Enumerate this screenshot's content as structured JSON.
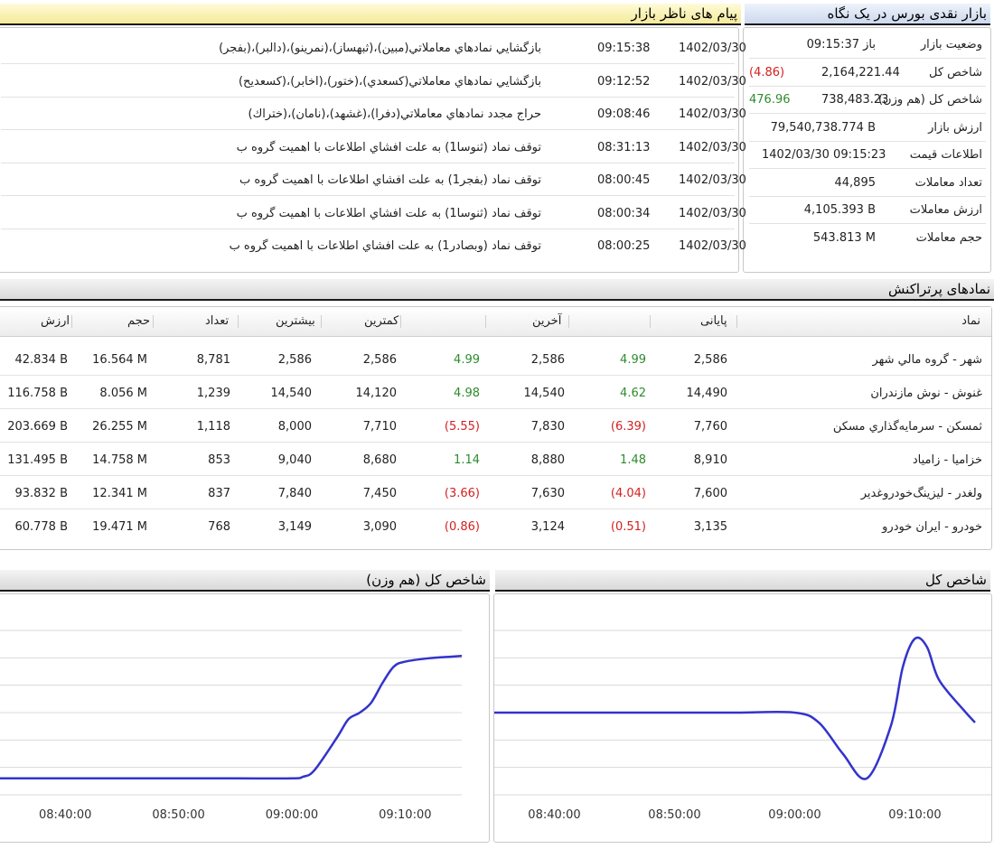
{
  "overview": {
    "title": "بازار نقدی بورس در یک نگاه",
    "rows": [
      {
        "label": "وضعیت بازار",
        "value": "باز 09:15:37",
        "change": "",
        "change_sign": ""
      },
      {
        "label": "شاخص کل",
        "value": "2,164,221.44",
        "change": "(4.86)",
        "change_sign": "neg"
      },
      {
        "label": "شاخص کل (هم وزن)",
        "value": "738,483.23",
        "change": "476.96",
        "change_sign": "pos"
      },
      {
        "label": "ارزش بازار",
        "value": "79,540,738.774 B",
        "change": "",
        "change_sign": ""
      },
      {
        "label": "اطلاعات قیمت",
        "value": "1402/03/30 09:15:23",
        "change": "",
        "change_sign": ""
      },
      {
        "label": "تعداد معاملات",
        "value": "44,895",
        "change": "",
        "change_sign": ""
      },
      {
        "label": "ارزش معاملات",
        "value": "4,105.393 B",
        "change": "",
        "change_sign": ""
      },
      {
        "label": "حجم معاملات",
        "value": "543.813 M",
        "change": "",
        "change_sign": ""
      }
    ]
  },
  "messages": {
    "title": "پیام های ناظر بازار",
    "rows": [
      {
        "date": "1402/03/30",
        "time": "09:15:38",
        "text": "بازگشايي نمادهاي معاملاتي(مبين)،(ثبهساز)،(نمرينو)،(دالبر)،(بفجر)"
      },
      {
        "date": "1402/03/30",
        "time": "09:12:52",
        "text": "بازگشايي نمادهاي معاملاتي(كسعدي)،(ختور)،(اخابر)،(كسعديح)"
      },
      {
        "date": "1402/03/30",
        "time": "09:08:46",
        "text": "حراج مجدد نمادهاي معاملاتي(دفرا)،(غشهد)،(نامان)،(ختراك)"
      },
      {
        "date": "1402/03/30",
        "time": "08:31:13",
        "text": "توقف نماد (ثنوسا1) به علت افشاي اطلاعات با اهميت گروه ب"
      },
      {
        "date": "1402/03/30",
        "time": "08:00:45",
        "text": "توقف نماد (بفجر1) به علت افشاي اطلاعات با اهميت گروه ب"
      },
      {
        "date": "1402/03/30",
        "time": "08:00:34",
        "text": "توقف نماد (ثنوسا1) به علت افشاي اطلاعات با اهميت گروه ب"
      },
      {
        "date": "1402/03/30",
        "time": "08:00:25",
        "text": "توقف نماد (وبصادر1) به علت افشاي اطلاعات با اهميت گروه ب"
      }
    ]
  },
  "symbols": {
    "title": "نمادهای پرتراکنش",
    "headers": {
      "symbol": "نماد",
      "close": "پایانی",
      "last": "آخرین",
      "low": "کمترین",
      "high": "بیشترین",
      "count": "تعداد",
      "volume": "حجم",
      "value": "ارزش"
    },
    "rows": [
      {
        "name": "شهر - گروه مالي شهر",
        "close": "2,586",
        "close_chg": "4.99",
        "close_sign": "pos",
        "last": "2,586",
        "last_chg": "4.99",
        "last_sign": "pos",
        "low": "2,586",
        "high": "2,586",
        "count": "8,781",
        "volume": "16.564 M",
        "value": "42.834 B"
      },
      {
        "name": "غنوش - نوش مازندران",
        "close": "14,490",
        "close_chg": "4.62",
        "close_sign": "pos",
        "last": "14,540",
        "last_chg": "4.98",
        "last_sign": "pos",
        "low": "14,120",
        "high": "14,540",
        "count": "1,239",
        "volume": "8.056 M",
        "value": "116.758 B"
      },
      {
        "name": "ثمسكن - سرمايه‌گذاري مسكن",
        "close": "7,760",
        "close_chg": "(6.39)",
        "close_sign": "neg",
        "last": "7,830",
        "last_chg": "(5.55)",
        "last_sign": "neg",
        "low": "7,710",
        "high": "8,000",
        "count": "1,118",
        "volume": "26.255 M",
        "value": "203.669 B"
      },
      {
        "name": "خزاميا - زامياد",
        "close": "8,910",
        "close_chg": "1.48",
        "close_sign": "pos",
        "last": "8,880",
        "last_chg": "1.14",
        "last_sign": "pos",
        "low": "8,680",
        "high": "9,040",
        "count": "853",
        "volume": "14.758 M",
        "value": "131.495 B"
      },
      {
        "name": "ولغدر - ليزينگ‌خودروغدير",
        "close": "7,600",
        "close_chg": "(4.04)",
        "close_sign": "neg",
        "last": "7,630",
        "last_chg": "(3.66)",
        "last_sign": "neg",
        "low": "7,450",
        "high": "7,840",
        "count": "837",
        "volume": "12.341 M",
        "value": "93.832 B"
      },
      {
        "name": "خودرو - ايران خودرو",
        "close": "3,135",
        "close_chg": "(0.51)",
        "close_sign": "neg",
        "last": "3,124",
        "last_chg": "(0.86)",
        "last_sign": "neg",
        "low": "3,090",
        "high": "3,149",
        "count": "768",
        "volume": "19.471 M",
        "value": "60.778 B"
      }
    ]
  },
  "colors": {
    "line": "#3333cc",
    "positive": "#2e8b2e",
    "negative": "#d42020",
    "grid": "#d8d8d8"
  },
  "chart_data": [
    {
      "type": "line",
      "title": "شاخص کل",
      "x": [
        "08:35:00",
        "08:40:00",
        "08:45:00",
        "08:50:00",
        "08:55:00",
        "09:00:00",
        "09:02:00",
        "09:04:00",
        "09:06:00",
        "09:08:00",
        "09:09:00",
        "09:10:00",
        "09:11:00",
        "09:12:00",
        "09:14:00",
        "09:15:00"
      ],
      "y": [
        0.5,
        0.5,
        0.5,
        0.5,
        0.5,
        0.5,
        0.44,
        0.25,
        0.1,
        0.42,
        0.78,
        0.95,
        0.9,
        0.7,
        0.52,
        0.44
      ],
      "xticks": [
        "08:40:00",
        "08:50:00",
        "09:00:00",
        "09:10:00"
      ],
      "ylim": [
        0,
        1
      ],
      "grid": true
    },
    {
      "type": "line",
      "title": "شاخص کل (هم وزن)",
      "x": [
        "08:34:00",
        "08:40:00",
        "08:45:00",
        "08:50:00",
        "08:55:00",
        "09:00:00",
        "09:01:00",
        "09:02:00",
        "09:04:00",
        "09:05:00",
        "09:06:00",
        "09:07:00",
        "09:08:00",
        "09:09:00",
        "09:10:00",
        "09:12:00",
        "09:14:00",
        "09:15:00"
      ],
      "y": [
        0.1,
        0.1,
        0.1,
        0.1,
        0.1,
        0.1,
        0.11,
        0.15,
        0.35,
        0.46,
        0.5,
        0.56,
        0.68,
        0.78,
        0.81,
        0.83,
        0.84,
        0.845
      ],
      "xticks": [
        "08:40:00",
        "08:50:00",
        "09:00:00",
        "09:10:00"
      ],
      "ylim": [
        0,
        1
      ],
      "grid": true
    }
  ]
}
